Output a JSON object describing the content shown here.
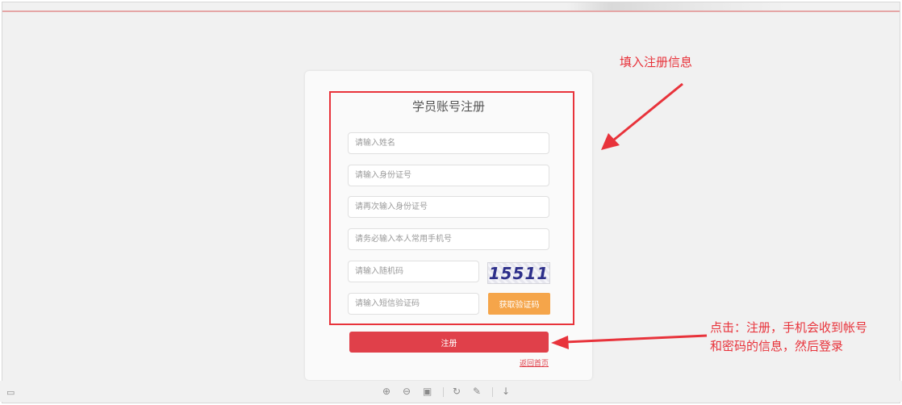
{
  "form": {
    "title": "学员账号注册",
    "name_placeholder": "请输入姓名",
    "id_placeholder": "请输入身份证号",
    "id_confirm_placeholder": "请再次输入身份证号",
    "phone_placeholder": "请务必输入本人常用手机号",
    "random_code_placeholder": "请输入随机码",
    "captcha_text": "15511",
    "sms_code_placeholder": "请输入短信验证码",
    "sms_button_label": "获取验证码",
    "register_button_label": "注册",
    "back_home_label": "返回首页"
  },
  "annotations": {
    "fill_info": "填入注册信息",
    "click_register_line1": "点击：注册，手机会收到帐号",
    "click_register_line2": "和密码的信息，然后登录"
  },
  "colors": {
    "annotation_red": "#e8333b",
    "register_button": "#e0404a",
    "sms_button": "#f5a54a"
  },
  "toolbar": {
    "icons": [
      "zoom-in-icon",
      "zoom-out-icon",
      "fit-icon",
      "rotate-icon",
      "edit-icon",
      "download-icon"
    ]
  }
}
